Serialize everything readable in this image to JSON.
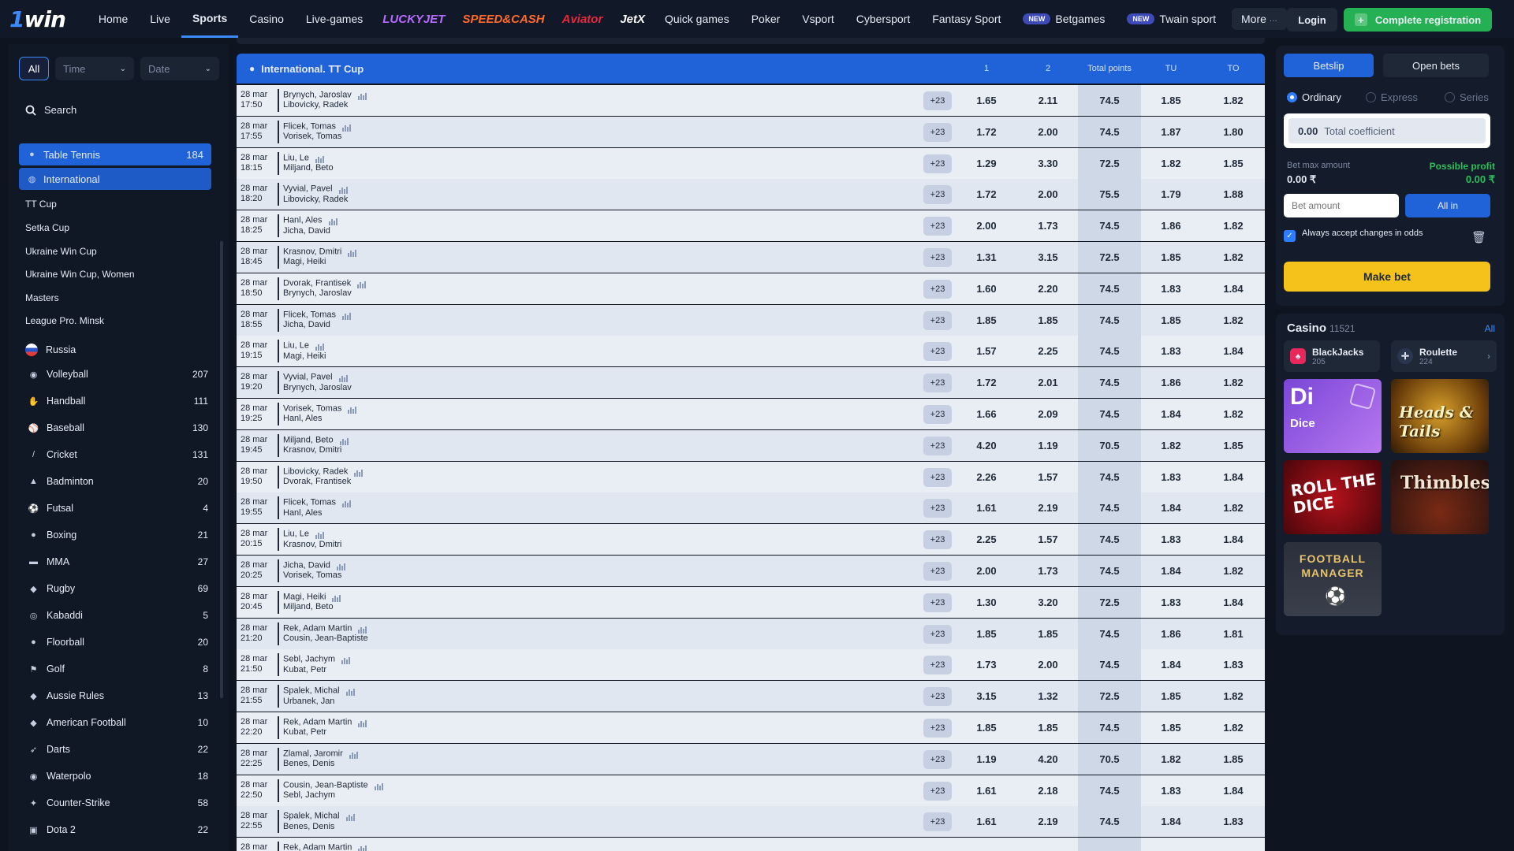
{
  "topnav": {
    "logo": "1win",
    "items": [
      {
        "label": "Home",
        "active": false
      },
      {
        "label": "Live",
        "active": false
      },
      {
        "label": "Sports",
        "active": true
      },
      {
        "label": "Casino",
        "active": false
      },
      {
        "label": "Live-games",
        "active": false
      }
    ],
    "brands": [
      {
        "label": "LUCKYJET",
        "color": "#b86bff"
      },
      {
        "label": "SPEED&CASH",
        "color": "#ff6a2b"
      },
      {
        "label": "Aviator",
        "color": "#e8283c"
      },
      {
        "label": "JetX",
        "color": "#ffffff"
      }
    ],
    "items2": [
      "Quick games",
      "Poker",
      "Vsport",
      "Cybersport",
      "Fantasy Sport"
    ],
    "new_badge": "NEW",
    "betgames": "Betgames",
    "twain": "Twain sport",
    "more": "More",
    "login": "Login",
    "register": "Complete registration"
  },
  "sidebar": {
    "filters": {
      "all": "All",
      "time": "Time",
      "date": "Date"
    },
    "search": "Search",
    "active_sport": {
      "label": "Table Tennis",
      "count": "184"
    },
    "active_region": "International",
    "tournaments": [
      "TT Cup",
      "Setka Cup",
      "Ukraine Win Cup",
      "Ukraine Win Cup, Women",
      "Masters",
      "League Pro. Minsk"
    ],
    "country": "Russia",
    "sports": [
      {
        "label": "Volleyball",
        "count": "207",
        "icon": "volleyball-icon",
        "glyph": "◉"
      },
      {
        "label": "Handball",
        "count": "111",
        "icon": "handball-icon",
        "glyph": "✋"
      },
      {
        "label": "Baseball",
        "count": "130",
        "icon": "baseball-icon",
        "glyph": "⚾"
      },
      {
        "label": "Cricket",
        "count": "131",
        "icon": "cricket-icon",
        "glyph": "/"
      },
      {
        "label": "Badminton",
        "count": "20",
        "icon": "badminton-icon",
        "glyph": "▲"
      },
      {
        "label": "Futsal",
        "count": "4",
        "icon": "futsal-icon",
        "glyph": "⚽"
      },
      {
        "label": "Boxing",
        "count": "21",
        "icon": "boxing-icon",
        "glyph": "●"
      },
      {
        "label": "MMA",
        "count": "27",
        "icon": "mma-icon",
        "glyph": "▬"
      },
      {
        "label": "Rugby",
        "count": "69",
        "icon": "rugby-icon",
        "glyph": "◆"
      },
      {
        "label": "Kabaddi",
        "count": "5",
        "icon": "kabaddi-icon",
        "glyph": "◎"
      },
      {
        "label": "Floorball",
        "count": "20",
        "icon": "floorball-icon",
        "glyph": "●"
      },
      {
        "label": "Golf",
        "count": "8",
        "icon": "golf-icon",
        "glyph": "⚑"
      },
      {
        "label": "Aussie Rules",
        "count": "13",
        "icon": "aussie-rules-icon",
        "glyph": "◆"
      },
      {
        "label": "American Football",
        "count": "10",
        "icon": "american-football-icon",
        "glyph": "◆"
      },
      {
        "label": "Darts",
        "count": "22",
        "icon": "darts-icon",
        "glyph": "➶"
      },
      {
        "label": "Waterpolo",
        "count": "18",
        "icon": "waterpolo-icon",
        "glyph": "◉"
      },
      {
        "label": "Counter-Strike",
        "count": "58",
        "icon": "counter-strike-icon",
        "glyph": "✦"
      },
      {
        "label": "Dota 2",
        "count": "22",
        "icon": "dota2-icon",
        "glyph": "▣"
      }
    ]
  },
  "table": {
    "title": "International. TT Cup",
    "columns": [
      "1",
      "2",
      "Total points",
      "TU",
      "TO"
    ],
    "rows": [
      {
        "date": "28 mar",
        "time": "17:50",
        "p1": "Brynych, Jaroslav",
        "p2": "Libovicky, Radek",
        "more": "+23",
        "o1": "1.65",
        "o2": "2.11",
        "total": "74.5",
        "tu": "1.85",
        "to": "1.82"
      },
      {
        "date": "28 mar",
        "time": "17:55",
        "p1": "Flicek, Tomas",
        "p2": "Vorisek, Tomas",
        "more": "+23",
        "o1": "1.72",
        "o2": "2.00",
        "total": "74.5",
        "tu": "1.87",
        "to": "1.80"
      },
      {
        "date": "28 mar",
        "time": "18:15",
        "p1": "Liu, Le",
        "p2": "Miljand, Beto",
        "more": "+23",
        "o1": "1.29",
        "o2": "3.30",
        "total": "72.5",
        "tu": "1.82",
        "to": "1.85"
      },
      {
        "date": "28 mar",
        "time": "18:20",
        "p1": "Vyvial, Pavel",
        "p2": "Libovicky, Radek",
        "more": "+23",
        "o1": "1.72",
        "o2": "2.00",
        "total": "75.5",
        "tu": "1.79",
        "to": "1.88"
      },
      {
        "date": "28 mar",
        "time": "18:25",
        "p1": "Hanl, Ales",
        "p2": "Jicha, David",
        "more": "+23",
        "o1": "2.00",
        "o2": "1.73",
        "total": "74.5",
        "tu": "1.86",
        "to": "1.82"
      },
      {
        "date": "28 mar",
        "time": "18:45",
        "p1": "Krasnov, Dmitri",
        "p2": "Magi, Heiki",
        "more": "+23",
        "o1": "1.31",
        "o2": "3.15",
        "total": "72.5",
        "tu": "1.85",
        "to": "1.82"
      },
      {
        "date": "28 mar",
        "time": "18:50",
        "p1": "Dvorak, Frantisek",
        "p2": "Brynych, Jaroslav",
        "more": "+23",
        "o1": "1.60",
        "o2": "2.20",
        "total": "74.5",
        "tu": "1.83",
        "to": "1.84"
      },
      {
        "date": "28 mar",
        "time": "18:55",
        "p1": "Flicek, Tomas",
        "p2": "Jicha, David",
        "more": "+23",
        "o1": "1.85",
        "o2": "1.85",
        "total": "74.5",
        "tu": "1.85",
        "to": "1.82"
      },
      {
        "date": "28 mar",
        "time": "19:15",
        "p1": "Liu, Le",
        "p2": "Magi, Heiki",
        "more": "+23",
        "o1": "1.57",
        "o2": "2.25",
        "total": "74.5",
        "tu": "1.83",
        "to": "1.84"
      },
      {
        "date": "28 mar",
        "time": "19:20",
        "p1": "Vyvial, Pavel",
        "p2": "Brynych, Jaroslav",
        "more": "+23",
        "o1": "1.72",
        "o2": "2.01",
        "total": "74.5",
        "tu": "1.86",
        "to": "1.82"
      },
      {
        "date": "28 mar",
        "time": "19:25",
        "p1": "Vorisek, Tomas",
        "p2": "Hanl, Ales",
        "more": "+23",
        "o1": "1.66",
        "o2": "2.09",
        "total": "74.5",
        "tu": "1.84",
        "to": "1.82"
      },
      {
        "date": "28 mar",
        "time": "19:45",
        "p1": "Miljand, Beto",
        "p2": "Krasnov, Dmitri",
        "more": "+23",
        "o1": "4.20",
        "o2": "1.19",
        "total": "70.5",
        "tu": "1.82",
        "to": "1.85"
      },
      {
        "date": "28 mar",
        "time": "19:50",
        "p1": "Libovicky, Radek",
        "p2": "Dvorak, Frantisek",
        "more": "+23",
        "o1": "2.26",
        "o2": "1.57",
        "total": "74.5",
        "tu": "1.83",
        "to": "1.84"
      },
      {
        "date": "28 mar",
        "time": "19:55",
        "p1": "Flicek, Tomas",
        "p2": "Hanl, Ales",
        "more": "+23",
        "o1": "1.61",
        "o2": "2.19",
        "total": "74.5",
        "tu": "1.84",
        "to": "1.82"
      },
      {
        "date": "28 mar",
        "time": "20:15",
        "p1": "Liu, Le",
        "p2": "Krasnov, Dmitri",
        "more": "+23",
        "o1": "2.25",
        "o2": "1.57",
        "total": "74.5",
        "tu": "1.83",
        "to": "1.84"
      },
      {
        "date": "28 mar",
        "time": "20:25",
        "p1": "Jicha, David",
        "p2": "Vorisek, Tomas",
        "more": "+23",
        "o1": "2.00",
        "o2": "1.73",
        "total": "74.5",
        "tu": "1.84",
        "to": "1.82"
      },
      {
        "date": "28 mar",
        "time": "20:45",
        "p1": "Magi, Heiki",
        "p2": "Miljand, Beto",
        "more": "+23",
        "o1": "1.30",
        "o2": "3.20",
        "total": "72.5",
        "tu": "1.83",
        "to": "1.84"
      },
      {
        "date": "28 mar",
        "time": "21:20",
        "p1": "Rek, Adam Martin",
        "p2": "Cousin, Jean-Baptiste",
        "more": "+23",
        "o1": "1.85",
        "o2": "1.85",
        "total": "74.5",
        "tu": "1.86",
        "to": "1.81"
      },
      {
        "date": "28 mar",
        "time": "21:50",
        "p1": "Sebl, Jachym",
        "p2": "Kubat, Petr",
        "more": "+23",
        "o1": "1.73",
        "o2": "2.00",
        "total": "74.5",
        "tu": "1.84",
        "to": "1.83"
      },
      {
        "date": "28 mar",
        "time": "21:55",
        "p1": "Spalek, Michal",
        "p2": "Urbanek, Jan",
        "more": "+23",
        "o1": "3.15",
        "o2": "1.32",
        "total": "72.5",
        "tu": "1.85",
        "to": "1.82"
      },
      {
        "date": "28 mar",
        "time": "22:20",
        "p1": "Rek, Adam Martin",
        "p2": "Kubat, Petr",
        "more": "+23",
        "o1": "1.85",
        "o2": "1.85",
        "total": "74.5",
        "tu": "1.85",
        "to": "1.82"
      },
      {
        "date": "28 mar",
        "time": "22:25",
        "p1": "Zlamal, Jaromir",
        "p2": "Benes, Denis",
        "more": "+23",
        "o1": "1.19",
        "o2": "4.20",
        "total": "70.5",
        "tu": "1.82",
        "to": "1.85"
      },
      {
        "date": "28 mar",
        "time": "22:50",
        "p1": "Cousin, Jean-Baptiste",
        "p2": "Sebl, Jachym",
        "more": "+23",
        "o1": "1.61",
        "o2": "2.18",
        "total": "74.5",
        "tu": "1.83",
        "to": "1.84"
      },
      {
        "date": "28 mar",
        "time": "22:55",
        "p1": "Spalek, Michal",
        "p2": "Benes, Denis",
        "more": "+23",
        "o1": "1.61",
        "o2": "2.19",
        "total": "74.5",
        "tu": "1.84",
        "to": "1.83"
      },
      {
        "date": "28 mar",
        "time": "",
        "p1": "Rek, Adam Martin",
        "p2": "",
        "more": "",
        "o1": "",
        "o2": "",
        "total": "",
        "tu": "",
        "to": ""
      }
    ]
  },
  "betslip": {
    "tab_betslip": "Betslip",
    "tab_open": "Open bets",
    "modes": [
      "Ordinary",
      "Express",
      "Series"
    ],
    "coef_value": "0.00",
    "coef_label": "Total coefficient",
    "bet_max_label": "Bet max amount",
    "bet_max_value": "0.00 ₹",
    "profit_label": "Possible profit",
    "profit_value": "0.00 ₹",
    "bet_placeholder": "Bet amount",
    "all_in": "All in",
    "accept_changes": "Always accept changes in odds",
    "make_bet": "Make bet"
  },
  "casino": {
    "title": "Casino",
    "count": "11521",
    "all": "All",
    "chips": [
      {
        "label": "BlackJacks",
        "count": "205"
      },
      {
        "label": "Roulette",
        "count": "224"
      }
    ],
    "tiles": {
      "dice_big": "Di",
      "dice": "Dice",
      "heads_tails": "Heads & Tails",
      "roll_dice": "ROLL THE DICE",
      "thimbles": "Thimbles",
      "football_manager": "FOOTBALL MANAGER"
    }
  },
  "colors": {
    "accent_blue": "#2063d9",
    "register_green": "#26b054",
    "make_bet_yellow": "#f4c21a",
    "profit_green": "#2fbe5a"
  }
}
